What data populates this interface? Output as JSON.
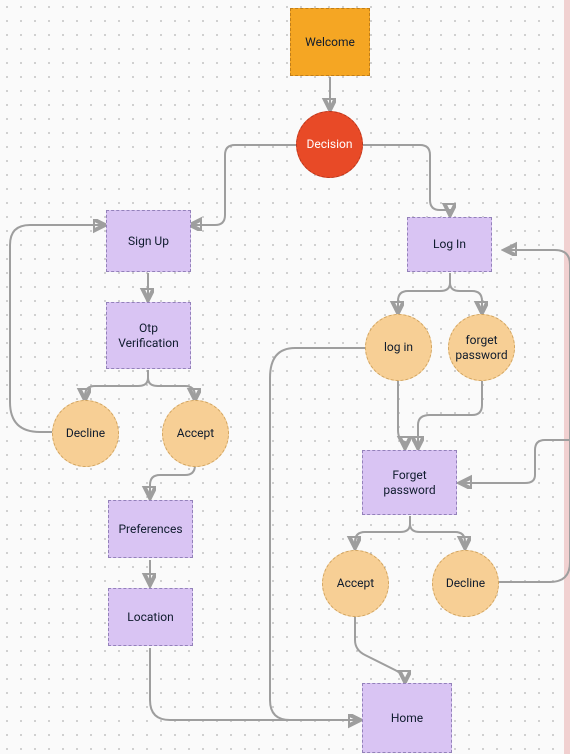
{
  "chart_data": {
    "type": "diagram",
    "title": "",
    "nodes": [
      {
        "id": "welcome",
        "label": "Welcome",
        "shape": "rect",
        "fill": "#f5a623"
      },
      {
        "id": "decision",
        "label": "Decision",
        "shape": "circle",
        "fill": "#e84a27"
      },
      {
        "id": "signup",
        "label": "Sign Up",
        "shape": "rect",
        "fill": "#d9c4f3"
      },
      {
        "id": "login",
        "label": "Log In",
        "shape": "rect",
        "fill": "#d9c4f3"
      },
      {
        "id": "otp",
        "label": "Otp Verification",
        "shape": "rect",
        "fill": "#d9c4f3"
      },
      {
        "id": "login_action",
        "label": "log in",
        "shape": "circle",
        "fill": "#f7cf95"
      },
      {
        "id": "forget_pw_action",
        "label": "forget password",
        "shape": "circle",
        "fill": "#f7cf95"
      },
      {
        "id": "decline1",
        "label": "Decline",
        "shape": "circle",
        "fill": "#f7cf95"
      },
      {
        "id": "accept1",
        "label": "Accept",
        "shape": "circle",
        "fill": "#f7cf95"
      },
      {
        "id": "forget_pw",
        "label": "Forget password",
        "shape": "rect",
        "fill": "#d9c4f3"
      },
      {
        "id": "preferences",
        "label": "Preferences",
        "shape": "rect",
        "fill": "#d9c4f3"
      },
      {
        "id": "location",
        "label": "Location",
        "shape": "rect",
        "fill": "#d9c4f3"
      },
      {
        "id": "accept2",
        "label": "Accept",
        "shape": "circle",
        "fill": "#f7cf95"
      },
      {
        "id": "decline2",
        "label": "Decline",
        "shape": "circle",
        "fill": "#f7cf95"
      },
      {
        "id": "home",
        "label": "Home",
        "shape": "rect",
        "fill": "#d9c4f3"
      }
    ],
    "edges": [
      {
        "from": "welcome",
        "to": "decision"
      },
      {
        "from": "decision",
        "to": "signup"
      },
      {
        "from": "decision",
        "to": "login"
      },
      {
        "from": "signup",
        "to": "otp"
      },
      {
        "from": "login",
        "to": "login_action"
      },
      {
        "from": "login",
        "to": "forget_pw_action"
      },
      {
        "from": "otp",
        "to": "decline1"
      },
      {
        "from": "otp",
        "to": "accept1"
      },
      {
        "from": "decline1",
        "to": "signup"
      },
      {
        "from": "accept1",
        "to": "preferences"
      },
      {
        "from": "login_action",
        "to": "forget_pw"
      },
      {
        "from": "login_action",
        "to": "home"
      },
      {
        "from": "forget_pw_action",
        "to": "forget_pw"
      },
      {
        "from": "forget_pw",
        "to": "accept2"
      },
      {
        "from": "forget_pw",
        "to": "decline2"
      },
      {
        "from": "accept2",
        "to": "home"
      },
      {
        "from": "decline2",
        "to": "login"
      },
      {
        "from": "preferences",
        "to": "location"
      },
      {
        "from": "location",
        "to": "home"
      }
    ]
  }
}
